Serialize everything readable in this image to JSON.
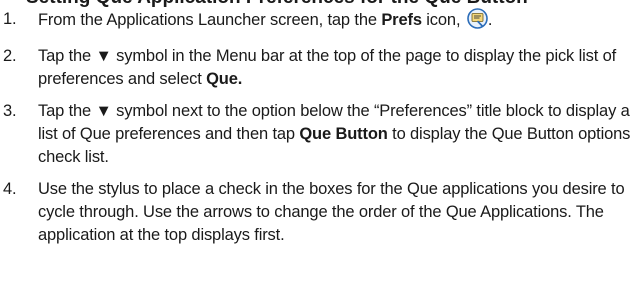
{
  "heading": "Setting Que Application Preferences for the Que Button",
  "steps": [
    {
      "number": "1.",
      "text_before": "From the Applications Launcher screen, tap the ",
      "bold": "Prefs",
      "text_after": " icon, ",
      "end": "."
    },
    {
      "number": "2.",
      "text_before": "Tap the ▼ symbol in the Menu bar at the top of the page to display the pick list of preferences and select ",
      "bold": "Que."
    },
    {
      "number": "3.",
      "text_before": "Tap the ▼ symbol next to the option below the “Preferences” title block to display a list of Que preferences and then tap ",
      "bold": "Que Button",
      "text_after": " to display the Que Button options check list."
    },
    {
      "number": "4.",
      "text_before": "Use the stylus to place a check in the boxes for the Que applications you desire to cycle through.  Use the arrows to change the order of the Que Applications.  The application at the top displays first."
    }
  ],
  "prefs_icon": {
    "name": "prefs-icon",
    "colors": {
      "ring": "#2b6cb8",
      "fill": "#e8f1fb",
      "card": "#f4d77a",
      "lines": "#3a3a3a"
    }
  }
}
